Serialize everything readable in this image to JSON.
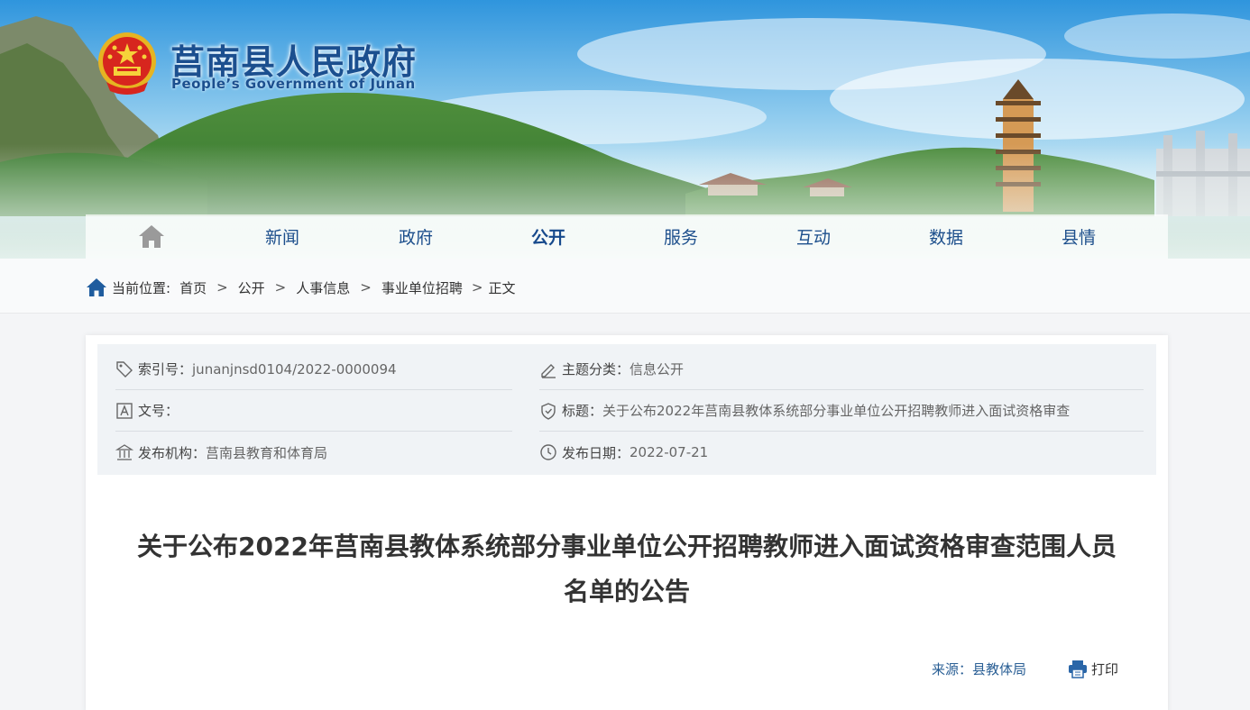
{
  "header": {
    "title": "莒南县人民政府",
    "subtitle": "People’s Government of Junan",
    "logo_icon": "national-emblem-icon"
  },
  "nav": {
    "home_icon": "home-icon",
    "items": [
      {
        "label": "新闻"
      },
      {
        "label": "政府"
      },
      {
        "label": "公开",
        "active": true
      },
      {
        "label": "服务"
      },
      {
        "label": "互动"
      },
      {
        "label": "数据"
      },
      {
        "label": "县情"
      }
    ]
  },
  "breadcrumb": {
    "prefix": "当前位置:",
    "items": [
      "首页",
      "公开",
      "人事信息",
      "事业单位招聘",
      "正文"
    ],
    "separator": ">"
  },
  "meta": {
    "index_label": "索引号：",
    "index_value": "junanjnsd0104/2022-0000094",
    "topic_label": "主题分类：",
    "topic_value": "信息公开",
    "docno_label": "文号：",
    "docno_value": "",
    "title_label": "标题：",
    "title_value": "关于公布2022年莒南县教体系统部分事业单位公开招聘教师进入面试资格审查",
    "org_label": "发布机构：",
    "org_value": "莒南县教育和体育局",
    "date_label": "发布日期：",
    "date_value": "2022-07-21"
  },
  "article": {
    "title_line1": "关于公布2022年莒南县教体系统部分事业单位公开招聘教师进入面试资格审查范围人员",
    "title_line2": "名单的公告",
    "source": "来源：县教体局",
    "print_label": "打印"
  },
  "colors": {
    "brand_blue": "#1b4f8f",
    "meta_bg": "#f0f3f6",
    "link_blue": "#2a5f95"
  }
}
